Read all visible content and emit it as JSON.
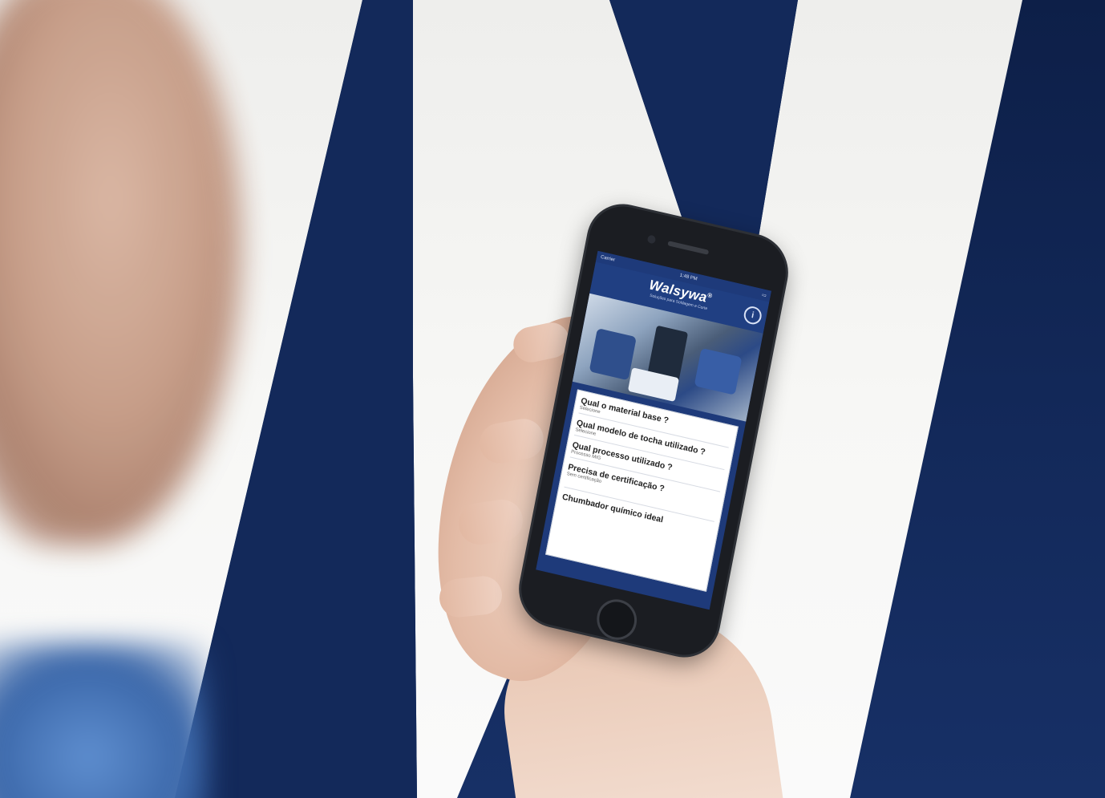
{
  "scene": {
    "background_color": "#13295a",
    "letter_color": "#f3f3f1"
  },
  "phone": {
    "status_bar": {
      "carrier": "Carrier",
      "time": "1:48 PM"
    },
    "app": {
      "brand": "Walsywa",
      "brand_mark": "®",
      "tagline": "Soluções para Soldagem e Corte",
      "info_icon_glyph": "i",
      "menu": [
        {
          "title": "Qual o material base ?",
          "subtitle": "Selecione"
        },
        {
          "title": "Qual modelo de tocha utilizado ?",
          "subtitle": "Selecione"
        },
        {
          "title": "Qual processo utilizado ?",
          "subtitle": "Processo MIG"
        },
        {
          "title": "Precisa de certificação ?",
          "subtitle": "Sem certificação"
        }
      ],
      "final_item": "Chumbador químico ideal"
    }
  }
}
